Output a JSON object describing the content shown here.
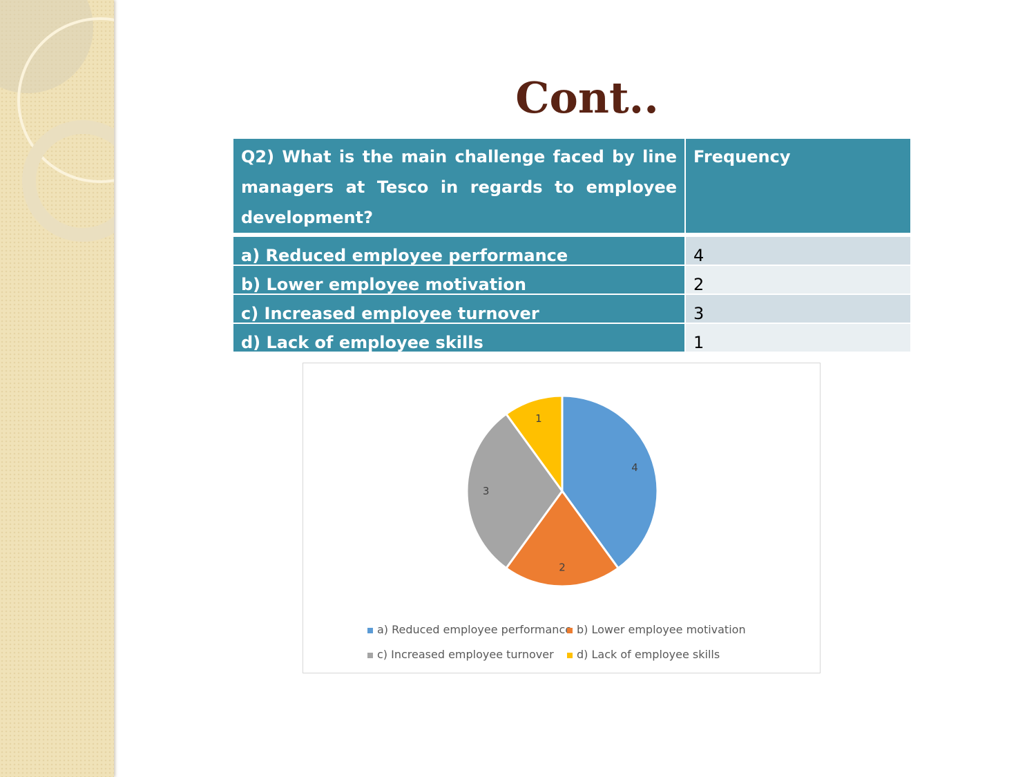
{
  "slide": {
    "title": "Cont.."
  },
  "table": {
    "header": {
      "question": "Q2) What is the main challenge faced by line managers at Tesco in regards to employee development?",
      "frequency": "Frequency"
    },
    "rows": [
      {
        "label": "a) Reduced employee performance",
        "value": "4"
      },
      {
        "label": "b) Lower employee motivation",
        "value": "2"
      },
      {
        "label": "c) Increased employee turnover",
        "value": "3"
      },
      {
        "label": "d) Lack of employee skills",
        "value": "1"
      }
    ]
  },
  "chart_data": {
    "type": "pie",
    "categories": [
      "a) Reduced employee performance",
      "b) Lower employee motivation",
      "c) Increased employee turnover",
      "d) Lack of employee skills"
    ],
    "values": [
      4,
      2,
      3,
      1
    ],
    "data_labels": [
      "4",
      "2",
      "3",
      "1"
    ],
    "colors": [
      "#5b9bd5",
      "#ed7d31",
      "#a5a5a5",
      "#ffc000"
    ],
    "legend_position": "bottom"
  }
}
